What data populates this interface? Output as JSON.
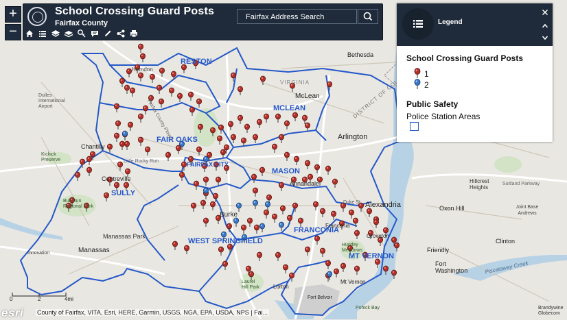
{
  "header": {
    "title": "School Crossing Guard Posts",
    "subtitle": "Fairfax County",
    "search_placeholder": "Fairfax Address Search"
  },
  "zoom": {
    "in_label": "+",
    "out_label": "−"
  },
  "legend": {
    "title": "Legend",
    "layer1_title": "School Crossing Guard Posts",
    "items": [
      {
        "label": "1",
        "color": "#c0392b"
      },
      {
        "label": "2",
        "color": "#3a78c9"
      }
    ],
    "layer2_title": "Public Safety",
    "layer2_sublabel": "Police Station Areas",
    "swatch_color": "#2458c8"
  },
  "scale": {
    "zero": "0",
    "mid": "2",
    "max": "4mi"
  },
  "footer": {
    "logo": "esri",
    "attribution": "County of Fairfax, VITA, Esri, HERE, Garmin, USGS, NGA, EPA, USDA, NPS | Fai..."
  },
  "map_labels": {
    "districts": [
      "RESTON",
      "MCLEAN",
      "FAIR OAKS",
      "FAIRFAX CITY",
      "MASON",
      "SULLY",
      "FRANCONIA",
      "WEST SPRINGFIELD",
      "MT VERNON"
    ],
    "places": [
      "Herndon",
      "Dulles International Airport",
      "Chantilly",
      "Centreville",
      "Manassas Park",
      "Manassas",
      "Burke",
      "Annandale",
      "Alexandria",
      "Arlington",
      "McLean",
      "Bethesda",
      "Lorton",
      "Fort Belvoir",
      "Mt Vernon",
      "Fort Washington",
      "Clinton",
      "Friendly",
      "Oxon Hill",
      "Joint Base Andrews",
      "Groveton",
      "Hillcrest Heights",
      "Suitland Parkway",
      "Piscataway Creek",
      "Laurel Hill Park",
      "Bull Run Regional Park",
      "Franconia",
      "Huntley Meadows",
      "Innovation",
      "Brandywine Globecom",
      "DISTRICT OF COLUMBIA",
      "VIRGINIA",
      "Duke St",
      "Fairfax County Pkwy",
      "Little Rocky Run",
      "Kickick Preserve",
      "Pohick Bay"
    ]
  },
  "map_colors": {
    "boundary": "#2458c8",
    "post_1": "#b3302a",
    "post_2": "#3a78c9",
    "water": "#a9c9df",
    "land": "#e8e6e1",
    "park": "#cfe0c3"
  }
}
